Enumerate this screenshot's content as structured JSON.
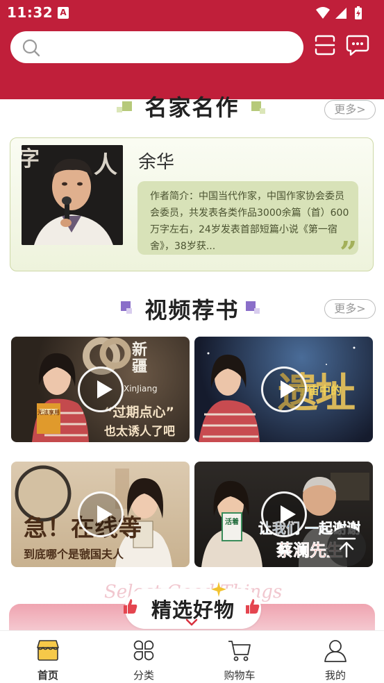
{
  "status_bar": {
    "time": "11:32",
    "app_icon_letter": "A"
  },
  "search": {
    "value": "",
    "placeholder": ""
  },
  "sections": {
    "famous_authors": {
      "title": "名家名作",
      "more_label": "更多>"
    },
    "video_books": {
      "title": "视频荐书",
      "more_label": "更多>"
    }
  },
  "author": {
    "name": "余华",
    "bio": "作者简介：中国当代作家，中国作家协会委员会委员，共发表各类作品3000余篇（首）600万字左右，24岁发表首部短篇小说《第一宿舍》，38岁获...",
    "quote_mark": "”"
  },
  "videos": [
    {
      "overlay_main": "新疆",
      "overlay_sub": "XinJiang",
      "caption_1": "“过期点心”",
      "caption_2": "也太诱人了吧",
      "book_label": "无法享用"
    },
    {
      "overlay_main": "遗址",
      "overlay_sub": "宇宙中的"
    },
    {
      "overlay_main": "急！在线等",
      "caption_2": "到底哪个是虢国夫人"
    },
    {
      "overlay_main": "让我们 一起谢谢",
      "caption_2": "蔡澜先生",
      "book_label": "活着"
    }
  ],
  "featured": {
    "title": "精选好物",
    "subtitle_en": "Select Good Things"
  },
  "bottom_nav": [
    {
      "label": "首页",
      "icon": "shop-icon",
      "active": true
    },
    {
      "label": "分类",
      "icon": "grid-icon",
      "active": false
    },
    {
      "label": "购物车",
      "icon": "cart-icon",
      "active": false
    },
    {
      "label": "我的",
      "icon": "user-icon",
      "active": false
    }
  ],
  "colors": {
    "brand": "#c01f3a",
    "author_accent": "#a3b05a",
    "video_accent": "#8a6ec9"
  }
}
